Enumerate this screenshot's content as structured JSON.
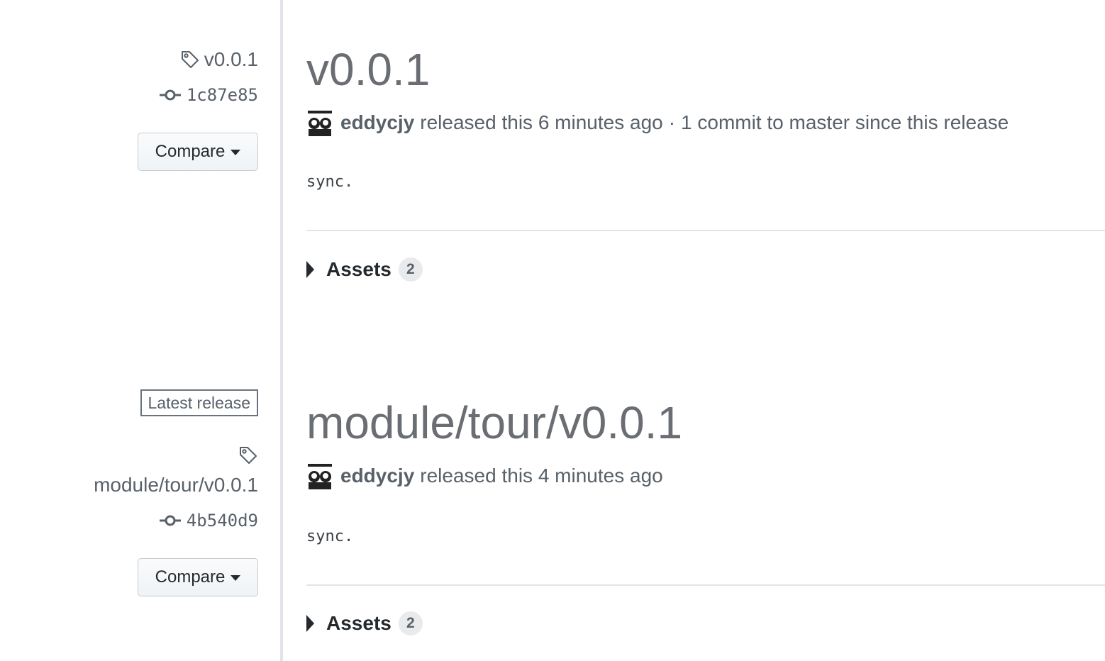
{
  "releases": [
    {
      "tag": "v0.0.1",
      "commit": "1c87e85",
      "compare_label": "Compare",
      "title": "v0.0.1",
      "author": "eddycjy",
      "released_text": "released this 6 minutes ago",
      "separator": "·",
      "commits_since": "1 commit to master since this release",
      "notes": "sync.",
      "assets_label": "Assets",
      "assets_count": "2"
    },
    {
      "badge": "Latest release",
      "tag": "module/tour/v0.0.1",
      "commit": "4b540d9",
      "compare_label": "Compare",
      "title": "module/tour/v0.0.1",
      "author": "eddycjy",
      "released_text": "released this 4 minutes ago",
      "notes": "sync.",
      "assets_label": "Assets",
      "assets_count": "2"
    }
  ],
  "icons": {
    "tag": "tag-icon",
    "commit": "git-commit-icon",
    "dropdown": "caret-down-icon",
    "expand": "caret-right-icon"
  },
  "colors": {
    "text_primary": "#24292e",
    "text_muted": "#586069",
    "title": "#6a6e73",
    "divider": "#e1e4e8"
  }
}
